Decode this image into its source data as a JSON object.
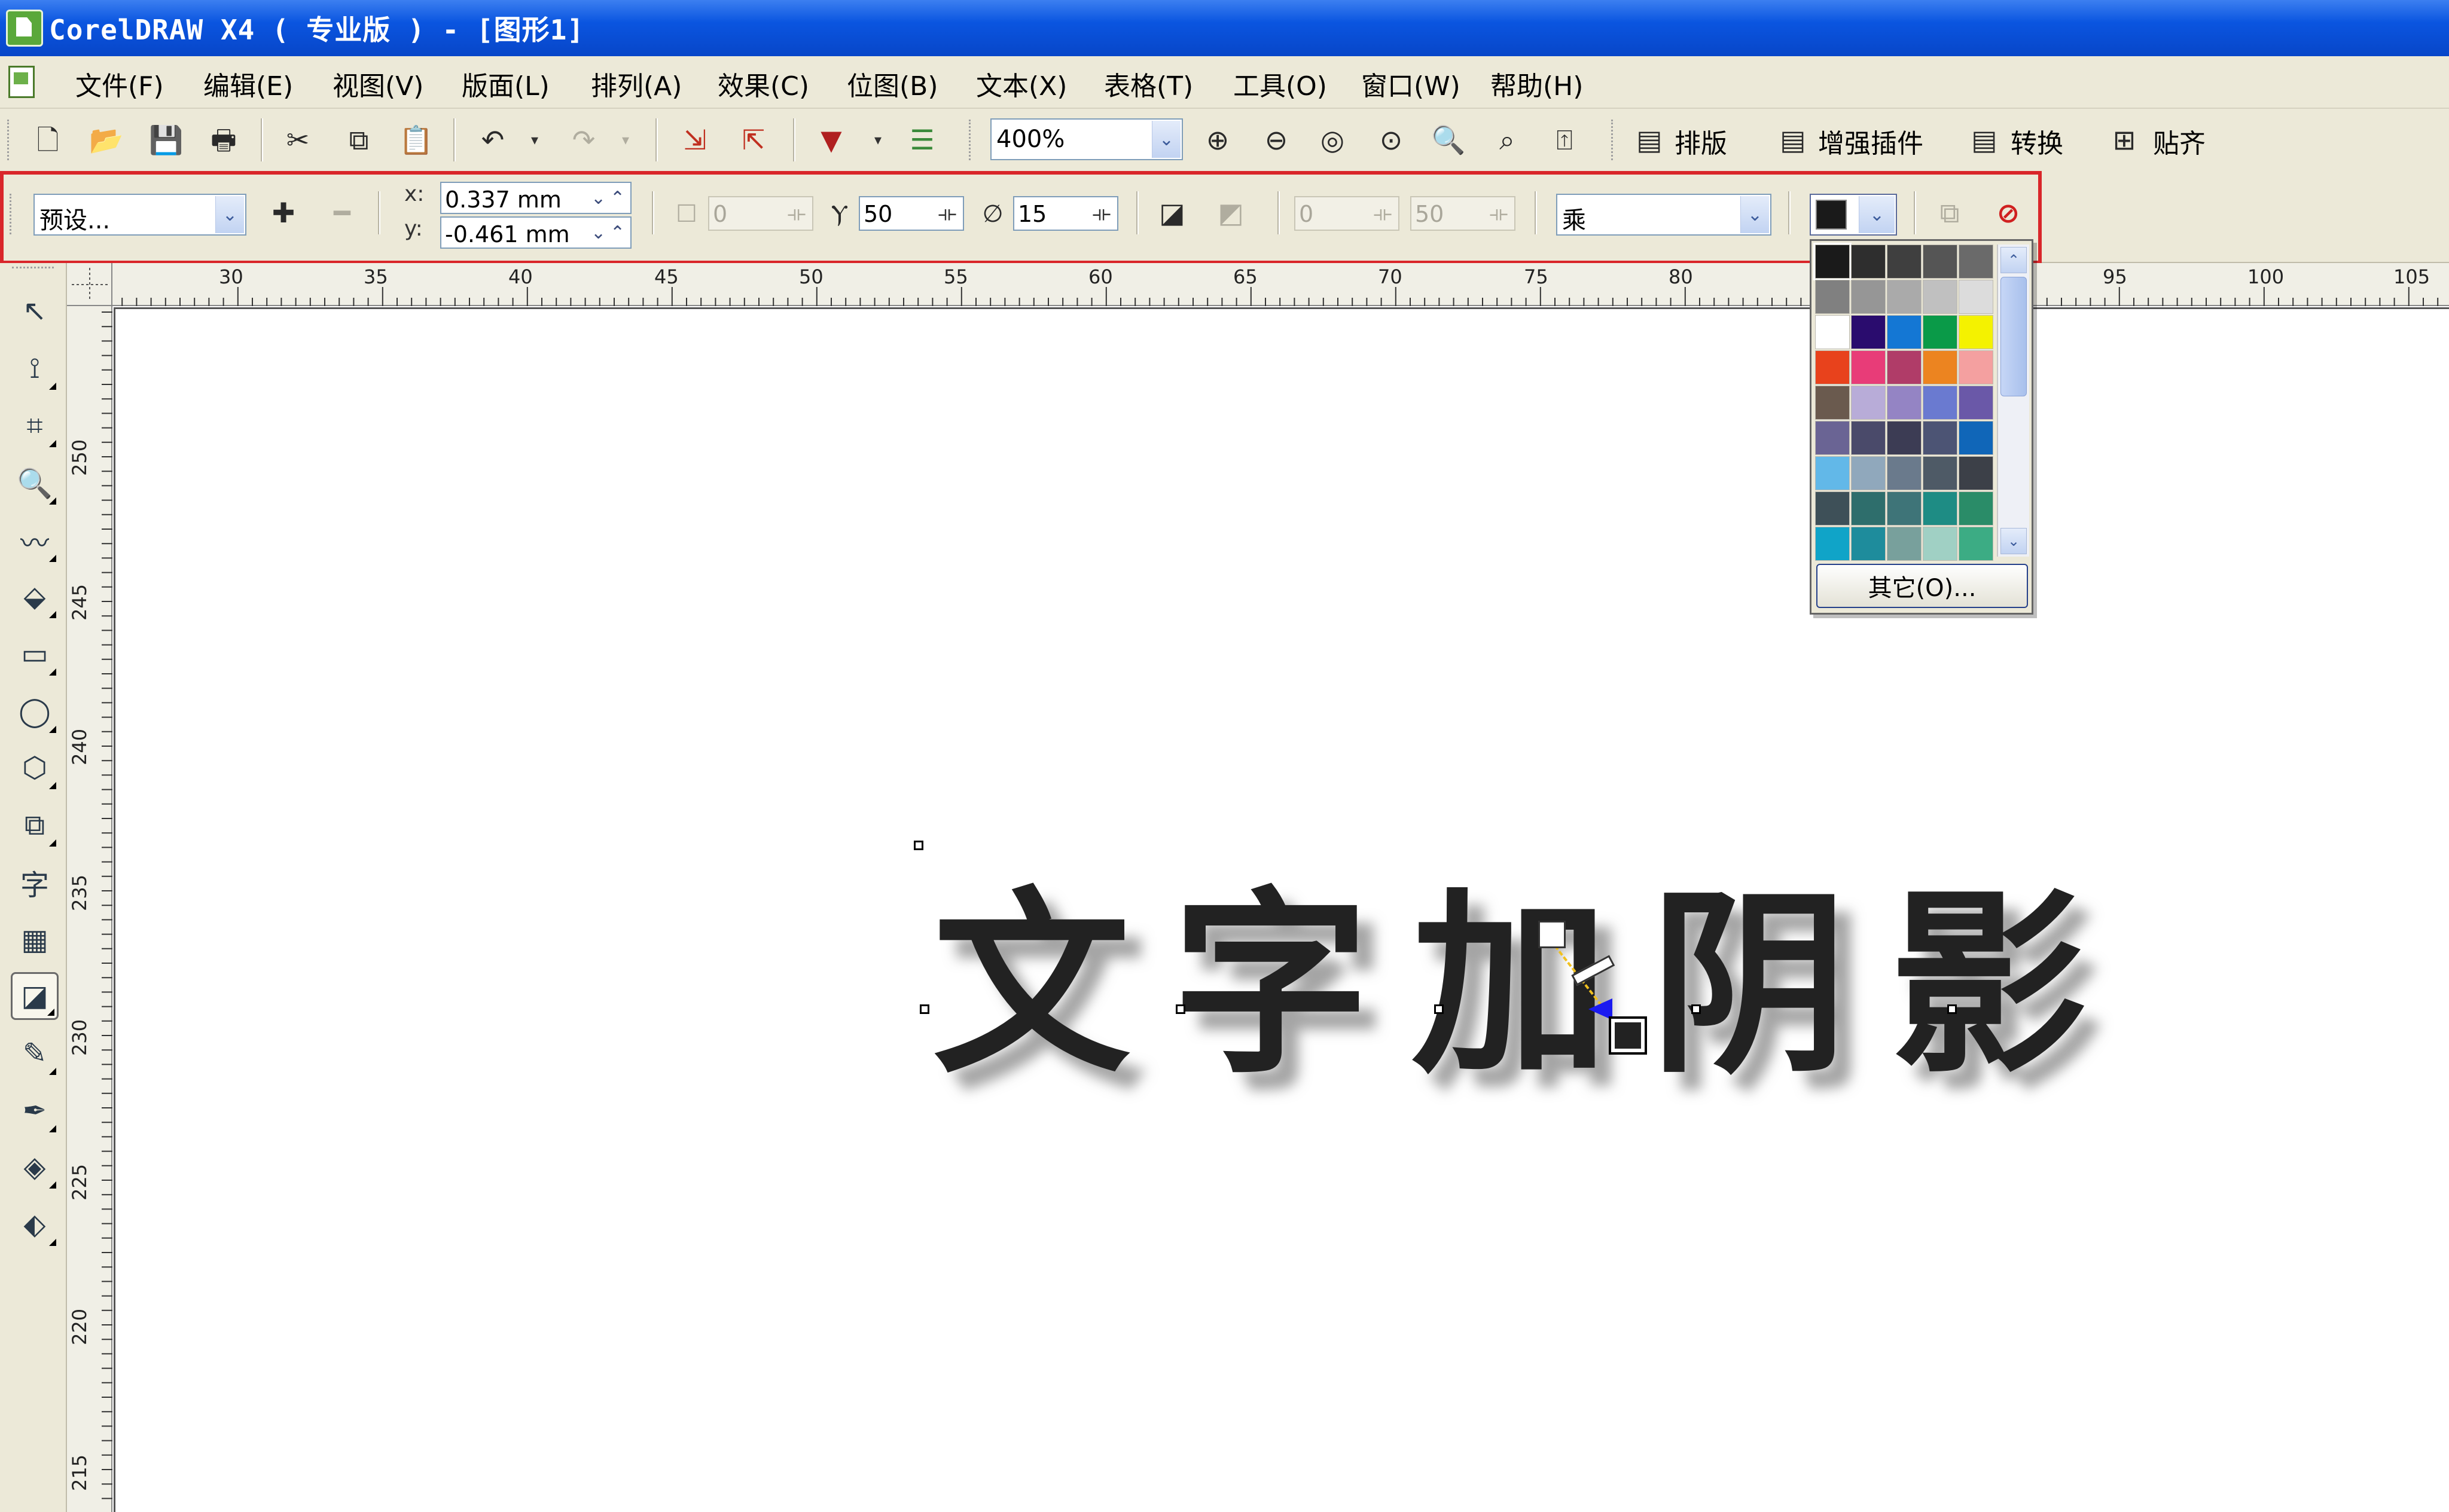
{
  "window": {
    "title": "CorelDRAW X4 ( 专业版 ) - [图形1]"
  },
  "menu": {
    "items": [
      "文件(F)",
      "编辑(E)",
      "视图(V)",
      "版面(L)",
      "排列(A)",
      "效果(C)",
      "位图(B)",
      "文本(X)",
      "表格(T)",
      "工具(O)",
      "窗口(W)",
      "帮助(H)"
    ]
  },
  "toolbar": {
    "zoom": "400%",
    "paibian_label": "排版",
    "plugin_label": "增强插件",
    "convert_label": "转换",
    "snap_label": "贴齐"
  },
  "propbar": {
    "preset": "预设...",
    "x_label": "x:",
    "x_value": "0.337 mm",
    "y_label": "y:",
    "y_value": "-0.461 mm",
    "angle_value": "0",
    "opacity_value": "50",
    "feather_value": "15",
    "stretch_value": "0",
    "fade_value": "50",
    "blend_mode": "乘",
    "shadow_color": "#1a1a1a"
  },
  "ruler": {
    "h_ticks": [
      "30",
      "35",
      "40",
      "45",
      "50",
      "55",
      "60",
      "65",
      "70",
      "75",
      "80",
      "95",
      "100",
      "105"
    ],
    "v_ticks": [
      "250",
      "245",
      "240",
      "235",
      "230",
      "225",
      "220",
      "215"
    ]
  },
  "canvas": {
    "art_text": "文字加阴影"
  },
  "color_popup": {
    "other_label": "其它(O)...",
    "swatches": [
      "#1a1a1a",
      "#2e2e2e",
      "#3f3f3f",
      "#555555",
      "#6a6a6a",
      "#808080",
      "#969696",
      "#aaaaaa",
      "#c0c0c0",
      "#dcdcdc",
      "#ffffff",
      "#2a0c6e",
      "#1477d4",
      "#0a9a48",
      "#f4f200",
      "#e8421c",
      "#e83c78",
      "#b03c68",
      "#ec8420",
      "#f4a0a0",
      "#6a5a4e",
      "#b8acd8",
      "#9484c4",
      "#6a7ad0",
      "#6a58a8",
      "#6a6494",
      "#4a4a6a",
      "#3c3c54",
      "#4c5474",
      "#1066b8",
      "#62b8e8",
      "#90a8bc",
      "#6a7a8c",
      "#4e5a66",
      "#3c4048",
      "#3e5058",
      "#2e6e6c",
      "#3e7478",
      "#1e8c84",
      "#2a8c68",
      "#10a4c8",
      "#1e8c9c",
      "#78a09c",
      "#a0d0c4",
      "#3cac84"
    ]
  }
}
